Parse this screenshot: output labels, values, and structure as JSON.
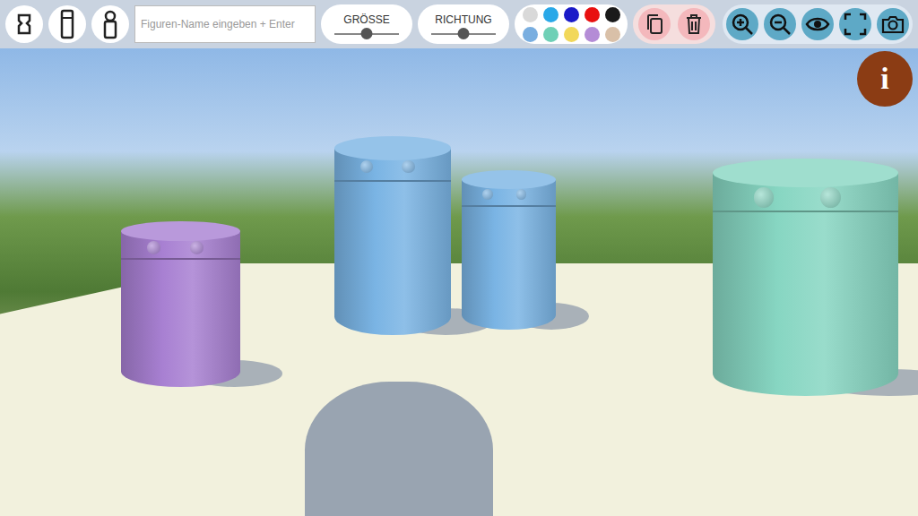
{
  "toolbar": {
    "name_field": {
      "placeholder": "Figuren-Name eingeben + Enter"
    },
    "sliders": [
      {
        "label": "GRÖSSE",
        "level": 0.5
      },
      {
        "label": "RICHTUNG",
        "level": 0.5
      }
    ],
    "palette": [
      {
        "color": "#d9d9d9",
        "selected": false
      },
      {
        "color": "#29a8e8",
        "selected": false
      },
      {
        "color": "#1a1ac8",
        "selected": false
      },
      {
        "color": "#e81010",
        "selected": false
      },
      {
        "color": "#1a1a1a",
        "selected": false
      },
      {
        "color": "#79aee0",
        "selected": false
      },
      {
        "color": "#6fd0b6",
        "selected": false
      },
      {
        "color": "#f2d85a",
        "selected": false
      },
      {
        "color": "#b48cd6",
        "selected": false
      },
      {
        "color": "#d9c0a8",
        "selected": false
      }
    ]
  },
  "info_button": {
    "label": "i"
  },
  "figures": [
    {
      "color": "#a880d2"
    },
    {
      "color": "#7ab4e4"
    },
    {
      "color": "#7ab4e4"
    },
    {
      "color": "#87d6c2"
    }
  ]
}
